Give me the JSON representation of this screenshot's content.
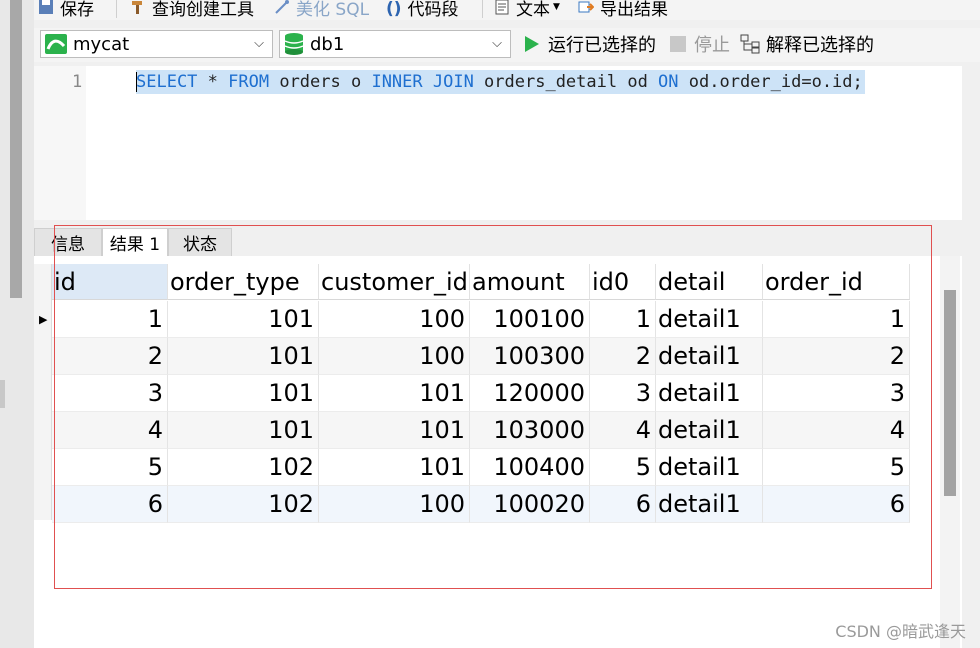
{
  "toolbar": {
    "save_label": "保存",
    "query_builder_label": "查询创建工具",
    "beautify_label": "美化 SQL",
    "snippet_label": "代码段",
    "text_label": "文本",
    "export_label": "导出结果"
  },
  "connection": {
    "value": "mycat"
  },
  "database": {
    "value": "db1"
  },
  "actions": {
    "run_selected_label": "运行已选择的",
    "stop_label": "停止",
    "explain_selected_label": "解释已选择的"
  },
  "editor": {
    "line_number": "1",
    "tokens": [
      {
        "t": "SELECT",
        "kw": true
      },
      {
        "t": " * ",
        "kw": false
      },
      {
        "t": "FROM",
        "kw": true
      },
      {
        "t": " orders o ",
        "kw": false
      },
      {
        "t": "INNER JOIN",
        "kw": true
      },
      {
        "t": " orders_detail od ",
        "kw": false
      },
      {
        "t": "ON",
        "kw": true
      },
      {
        "t": " od.order_id=o.id;",
        "kw": false
      }
    ]
  },
  "tabs": [
    {
      "label": "信息",
      "active": false
    },
    {
      "label": "结果 1",
      "active": true
    },
    {
      "label": "状态",
      "active": false
    }
  ],
  "results": {
    "columns": [
      "id",
      "order_type",
      "customer_id",
      "amount",
      "id0",
      "detail",
      "order_id"
    ],
    "numeric": [
      true,
      true,
      true,
      true,
      true,
      false,
      true
    ],
    "rows": [
      [
        "1",
        "101",
        "100",
        "100100",
        "1",
        "detail1",
        "1"
      ],
      [
        "2",
        "101",
        "100",
        "100300",
        "2",
        "detail1",
        "2"
      ],
      [
        "3",
        "101",
        "101",
        "120000",
        "3",
        "detail1",
        "3"
      ],
      [
        "4",
        "101",
        "101",
        "103000",
        "4",
        "detail1",
        "4"
      ],
      [
        "5",
        "102",
        "101",
        "100400",
        "5",
        "detail1",
        "5"
      ],
      [
        "6",
        "102",
        "100",
        "100020",
        "6",
        "detail1",
        "6"
      ]
    ],
    "current_row": 0
  },
  "watermark": "CSDN @暗武逢天",
  "colors": {
    "keyword": "#1e6fd0",
    "selection": "#cde3f7",
    "run_green": "#2bb24c",
    "highlight_box": "#e05050"
  }
}
